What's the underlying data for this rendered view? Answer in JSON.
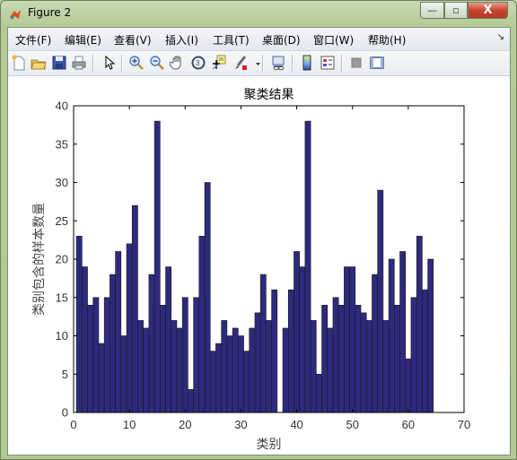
{
  "window": {
    "title": "Figure 2",
    "controls": {
      "minimize": "—",
      "maximize": "▫",
      "close": "X"
    }
  },
  "menubar": {
    "items": [
      {
        "label": "文件(F)"
      },
      {
        "label": "编辑(E)"
      },
      {
        "label": "查看(V)"
      },
      {
        "label": "插入(I)"
      },
      {
        "label": "工具(T)"
      },
      {
        "label": "桌面(D)"
      },
      {
        "label": "窗口(W)"
      },
      {
        "label": "帮助(H)"
      }
    ],
    "dock_icon": "dock-arrow-icon"
  },
  "toolbar": {
    "buttons": [
      {
        "icon": "new-figure-icon"
      },
      {
        "icon": "open-file-icon"
      },
      {
        "icon": "save-icon"
      },
      {
        "icon": "print-icon"
      },
      {
        "icon": "pointer-icon"
      },
      {
        "icon": "zoom-in-icon"
      },
      {
        "icon": "zoom-out-icon"
      },
      {
        "icon": "pan-hand-icon"
      },
      {
        "icon": "rotate-3d-icon"
      },
      {
        "icon": "data-cursor-icon"
      },
      {
        "icon": "brush-icon"
      },
      {
        "icon": "link-plot-icon"
      },
      {
        "icon": "colorbar-icon"
      },
      {
        "icon": "legend-icon"
      },
      {
        "icon": "hide-plot-tools-icon"
      },
      {
        "icon": "show-plot-tools-icon"
      }
    ]
  },
  "colors": {
    "bar_fill": "#2e2a7e",
    "bar_edge": "#1a1a1a",
    "axis": "#000000",
    "tick_text": "#333333"
  },
  "chart_data": {
    "type": "bar",
    "title": "聚类结果",
    "xlabel": "类别",
    "ylabel": "类别包含的样本数量",
    "xlim": [
      0,
      70
    ],
    "ylim": [
      0,
      40
    ],
    "xticks": [
      0,
      10,
      20,
      30,
      40,
      50,
      60,
      70
    ],
    "yticks": [
      0,
      5,
      10,
      15,
      20,
      25,
      30,
      35,
      40
    ],
    "grid": false,
    "categories": [
      1,
      2,
      3,
      4,
      5,
      6,
      7,
      8,
      9,
      10,
      11,
      12,
      13,
      14,
      15,
      16,
      17,
      18,
      19,
      20,
      21,
      22,
      23,
      24,
      25,
      26,
      27,
      28,
      29,
      30,
      31,
      32,
      33,
      34,
      35,
      36,
      37,
      38,
      39,
      40,
      41,
      42,
      43,
      44,
      45,
      46,
      47,
      48,
      49,
      50,
      51,
      52,
      53,
      54,
      55,
      56,
      57,
      58,
      59,
      60,
      61,
      62,
      63,
      64
    ],
    "values": [
      23,
      19,
      14,
      15,
      9,
      15,
      18,
      21,
      10,
      22,
      27,
      12,
      11,
      18,
      38,
      14,
      19,
      12,
      11,
      15,
      3,
      15,
      23,
      30,
      8,
      9,
      12,
      10,
      11,
      10,
      8,
      11,
      13,
      18,
      12,
      16,
      0,
      11,
      16,
      21,
      19,
      38,
      12,
      5,
      14,
      11,
      15,
      14,
      19,
      19,
      14,
      13,
      12,
      18,
      29,
      12,
      20,
      14,
      21,
      7,
      15,
      23,
      16,
      20
    ]
  }
}
